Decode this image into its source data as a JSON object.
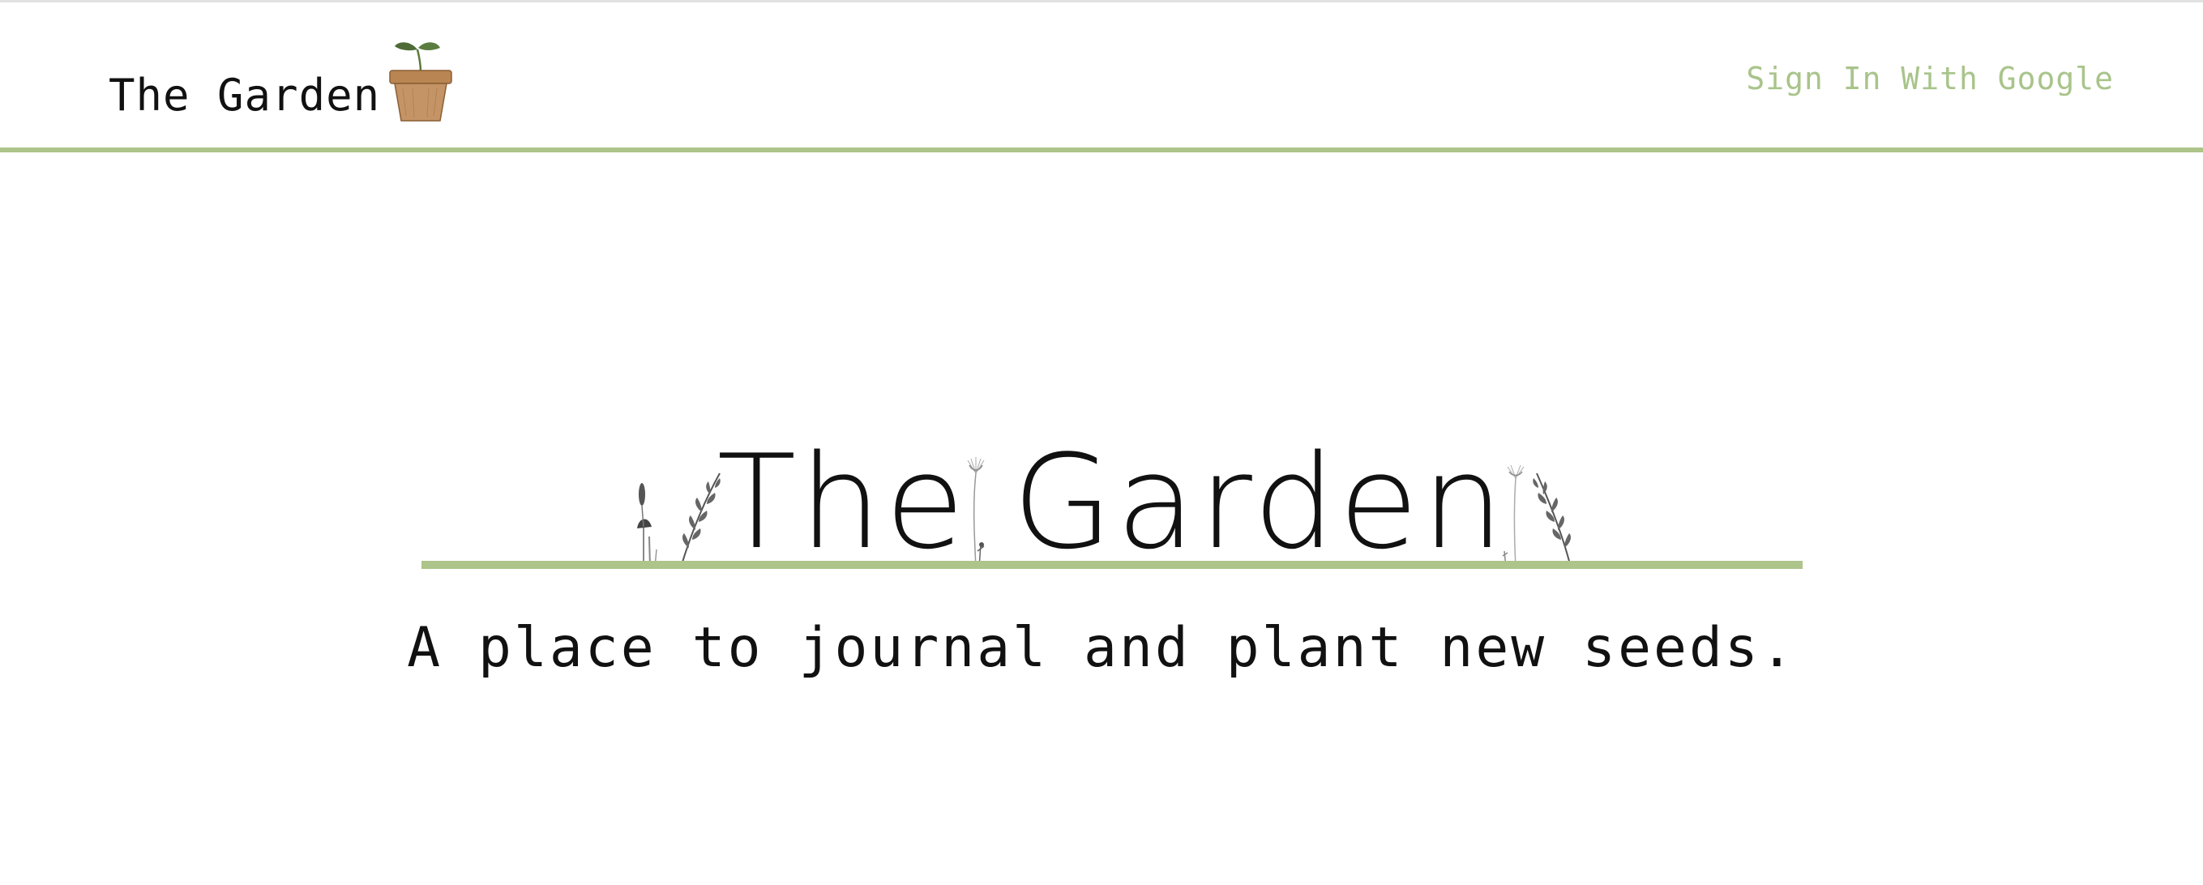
{
  "header": {
    "logo_text": "The Garden",
    "logo_icon": "flower-pot-sprout-icon",
    "signin_label": "Sign In With Google"
  },
  "hero": {
    "title": "The Garden",
    "tagline": "A place to journal and plant new seeds."
  },
  "colors": {
    "accent_green": "#adc48a",
    "signin_text": "#a9c48b",
    "text": "#111111",
    "background": "#ffffff"
  }
}
